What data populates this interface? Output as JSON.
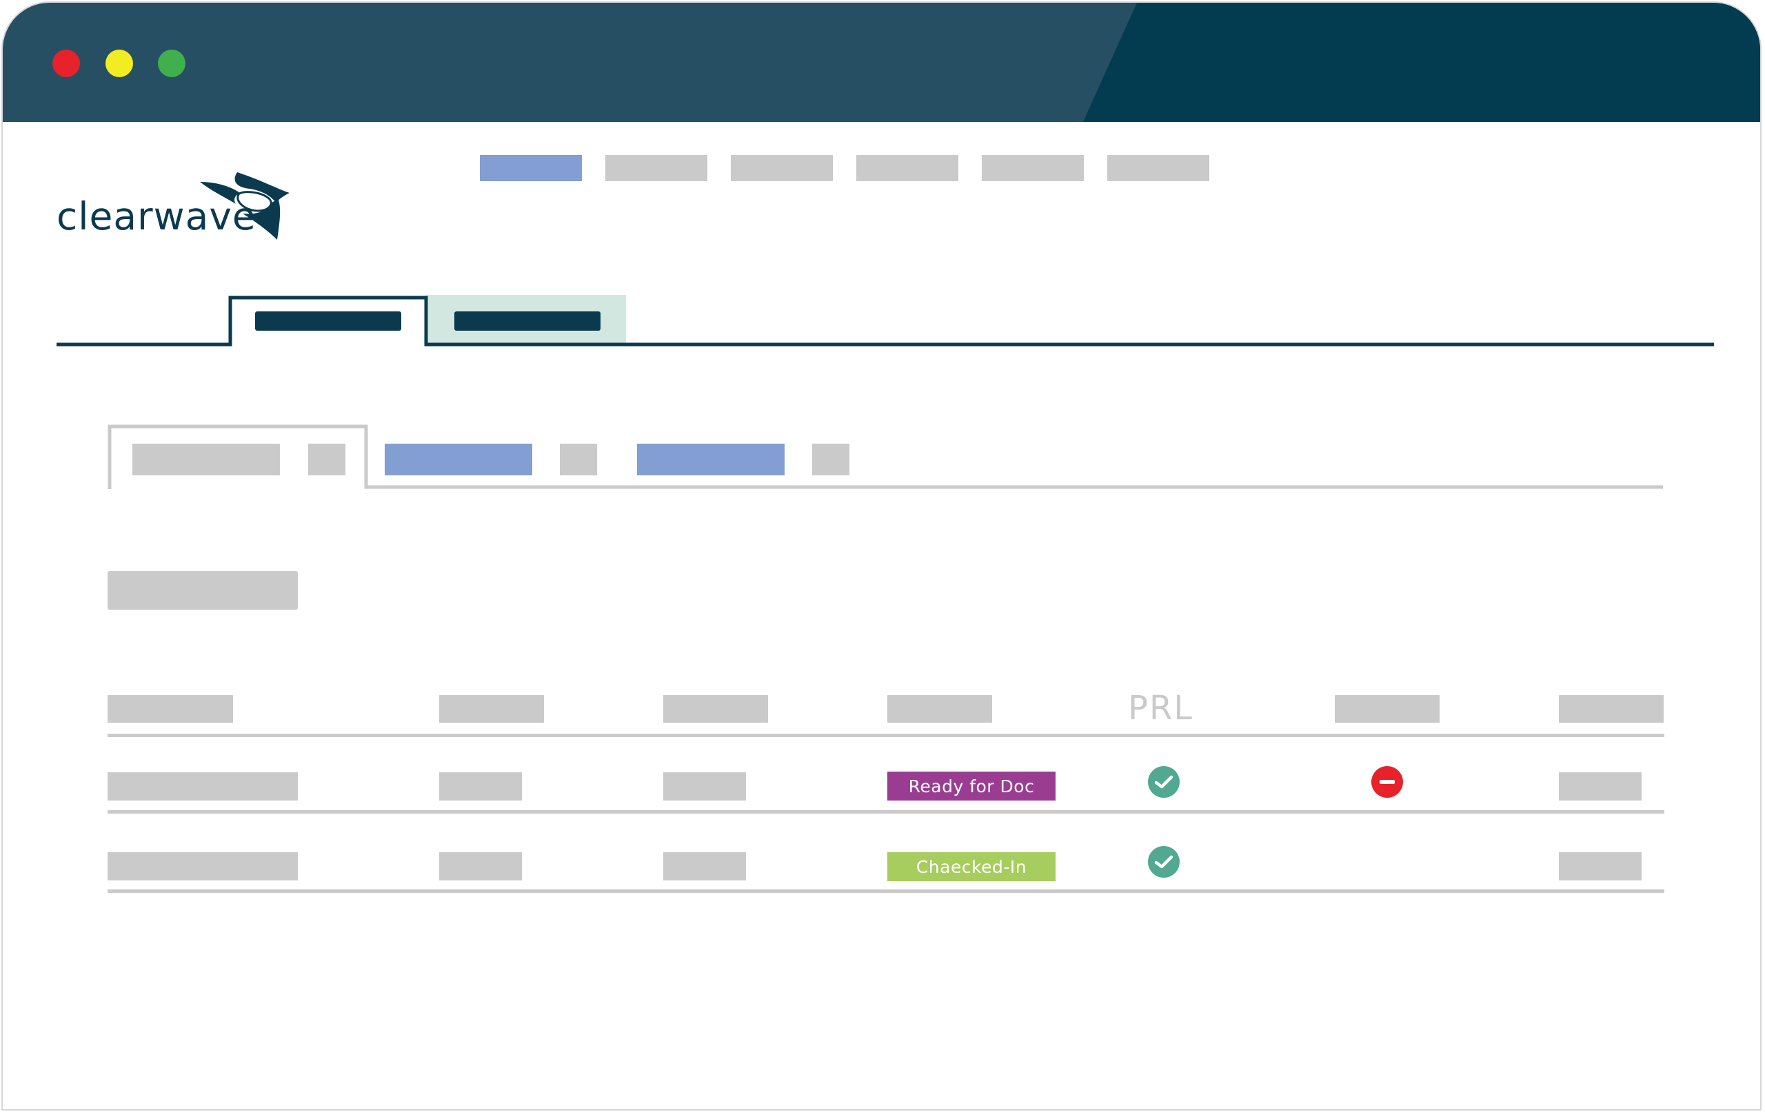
{
  "window": {
    "titlebar_color_left": "#264f63",
    "titlebar_color_right": "#033b50",
    "buttons": [
      {
        "name": "close",
        "color": "#e8222b"
      },
      {
        "name": "minimize",
        "color": "#f2ec23"
      },
      {
        "name": "maximize",
        "color": "#3fb04b"
      }
    ]
  },
  "brand": {
    "logo_text": "clearwave",
    "color": "#0b3a4e"
  },
  "colors": {
    "placeholder": "#cacaca",
    "highlight": "#829ed2",
    "tab_secondary_bg": "#d3e7e1",
    "ready_for_doc": "#9a3c92",
    "checked_in": "#a6cd5d",
    "check_icon": "#52a891",
    "blocked_icon": "#e8222b"
  },
  "table": {
    "header_label": "PRL",
    "rows": [
      {
        "status": "Ready for Doc",
        "prl": "check-icon",
        "flag": "blocked-icon"
      },
      {
        "status": "Chaecked-In",
        "prl": "check-icon",
        "flag": ""
      }
    ]
  }
}
